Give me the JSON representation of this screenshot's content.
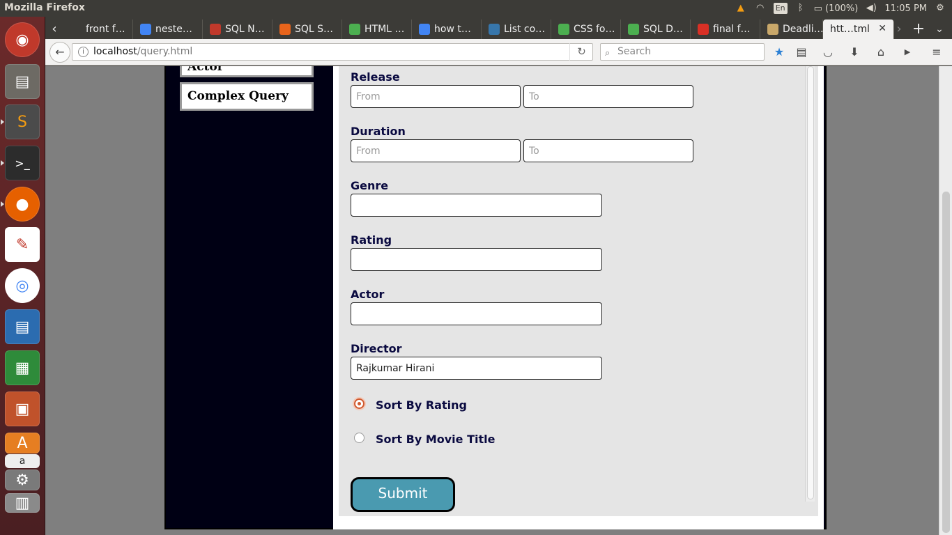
{
  "system_bar": {
    "app_title": "Mozilla Firefox",
    "keyboard_layout": "En",
    "battery": "(100%)",
    "clock": "11:05 PM"
  },
  "tabs": [
    {
      "label": "front f…",
      "icon": "generic-page-icon",
      "color": "#3c3b37"
    },
    {
      "label": "neste…",
      "icon": "google-icon",
      "color": "#4285f4"
    },
    {
      "label": "SQL N…",
      "icon": "sql-site-icon",
      "color": "#c0392b"
    },
    {
      "label": "SQL S…",
      "icon": "sql-server-icon",
      "color": "#e8641b"
    },
    {
      "label": "HTML …",
      "icon": "w3schools-icon",
      "color": "#4caf50"
    },
    {
      "label": "how t…",
      "icon": "google-icon",
      "color": "#4285f4"
    },
    {
      "label": "List co…",
      "icon": "python-icon",
      "color": "#3776ab"
    },
    {
      "label": "CSS fo…",
      "icon": "w3schools-icon",
      "color": "#4caf50"
    },
    {
      "label": "SQL D…",
      "icon": "w3schools-icon",
      "color": "#4caf50"
    },
    {
      "label": "final f…",
      "icon": "gmail-icon",
      "color": "#d93025"
    },
    {
      "label": "Deadli…",
      "icon": "hackerrank-icon",
      "color": "#c9a86a"
    },
    {
      "label": "htt…tml",
      "icon": "",
      "color": "#f2f1f0"
    }
  ],
  "navbar": {
    "url_host": "localhost",
    "url_path": "/query.html",
    "search_placeholder": "Search"
  },
  "sidebar": {
    "items": [
      {
        "label": "Actor"
      },
      {
        "label": "Complex Query"
      }
    ]
  },
  "form": {
    "release": {
      "label": "Release",
      "from_placeholder": "From",
      "to_placeholder": "To"
    },
    "duration": {
      "label": "Duration",
      "from_placeholder": "From",
      "to_placeholder": "To"
    },
    "genre": {
      "label": "Genre",
      "value": ""
    },
    "rating": {
      "label": "Rating",
      "value": ""
    },
    "actor": {
      "label": "Actor",
      "value": ""
    },
    "director": {
      "label": "Director",
      "value": "Rajkumar Hirani"
    },
    "sort_options": [
      {
        "label": "Sort By Rating",
        "checked": true
      },
      {
        "label": "Sort By Movie Title",
        "checked": false
      }
    ],
    "submit_label": "Submit"
  }
}
